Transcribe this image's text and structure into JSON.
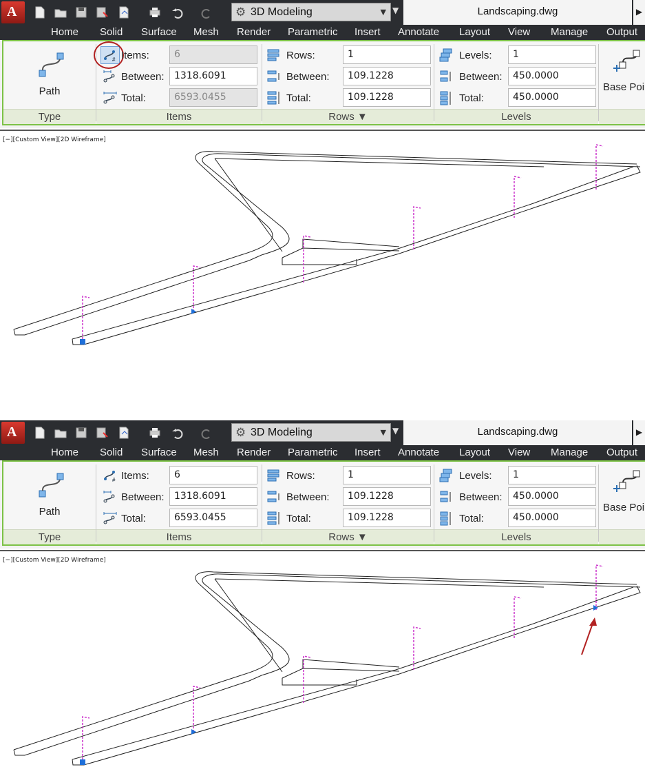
{
  "panels": [
    {
      "app_button": "A",
      "workspace": "3D Modeling",
      "document_title": "Landscaping.dwg",
      "tabs": [
        "Home",
        "Solid",
        "Surface",
        "Mesh",
        "Render",
        "Parametric",
        "Insert",
        "Annotate",
        "Layout",
        "View",
        "Manage",
        "Output"
      ],
      "ribbon": {
        "type_panel": {
          "button_label": "Path",
          "footer": "Type"
        },
        "items_panel": {
          "footer": "Items",
          "items_label": "Items:",
          "items_value": "6",
          "items_disabled": true,
          "between_label": "Between:",
          "between_value": "1318.6091",
          "total_label": "Total:",
          "total_value": "6593.0455",
          "total_disabled": true
        },
        "rows_panel": {
          "footer": "Rows ▼",
          "rows_label": "Rows:",
          "rows_value": "1",
          "between_label": "Between:",
          "between_value": "109.1228",
          "total_label": "Total:",
          "total_value": "109.1228"
        },
        "levels_panel": {
          "footer": "Levels",
          "levels_label": "Levels:",
          "levels_value": "1",
          "between_label": "Between:",
          "between_value": "450.0000",
          "total_label": "Total:",
          "total_value": "450.0000"
        },
        "base_point_label": "Base Poin"
      },
      "viewport_label": "[−][Custom View][2D Wireframe]",
      "items_button_circled": true,
      "arrow_annotation": false
    },
    {
      "app_button": "A",
      "workspace": "3D Modeling",
      "document_title": "Landscaping.dwg",
      "tabs": [
        "Home",
        "Solid",
        "Surface",
        "Mesh",
        "Render",
        "Parametric",
        "Insert",
        "Annotate",
        "Layout",
        "View",
        "Manage",
        "Output"
      ],
      "ribbon": {
        "type_panel": {
          "button_label": "Path",
          "footer": "Type"
        },
        "items_panel": {
          "footer": "Items",
          "items_label": "Items:",
          "items_value": "6",
          "items_disabled": false,
          "between_label": "Between:",
          "between_value": "1318.6091",
          "total_label": "Total:",
          "total_value": "6593.0455",
          "total_disabled": false
        },
        "rows_panel": {
          "footer": "Rows ▼",
          "rows_label": "Rows:",
          "rows_value": "1",
          "between_label": "Between:",
          "between_value": "109.1228",
          "total_label": "Total:",
          "total_value": "109.1228"
        },
        "levels_panel": {
          "footer": "Levels",
          "levels_label": "Levels:",
          "levels_value": "1",
          "between_label": "Between:",
          "between_value": "450.0000",
          "total_label": "Total:",
          "total_value": "450.0000"
        },
        "base_point_label": "Base Poin"
      },
      "viewport_label": "[−][Custom View][2D Wireframe]",
      "items_button_circled": false,
      "arrow_annotation": true
    }
  ],
  "colors": {
    "titlebar": "#2b2d31",
    "ribbon_border": "#7cc246",
    "flag": "#cc33cc",
    "grip": "#1e6fd9",
    "annotation": "#b22222"
  },
  "icons": [
    "app-logo-icon",
    "new-icon",
    "open-icon",
    "save-icon",
    "save-as-icon",
    "plot-icon",
    "print-icon",
    "undo-icon",
    "redo-icon",
    "gear-icon",
    "path-icon",
    "items-icon",
    "rows-icon",
    "levels-icon",
    "base-point-icon"
  ]
}
